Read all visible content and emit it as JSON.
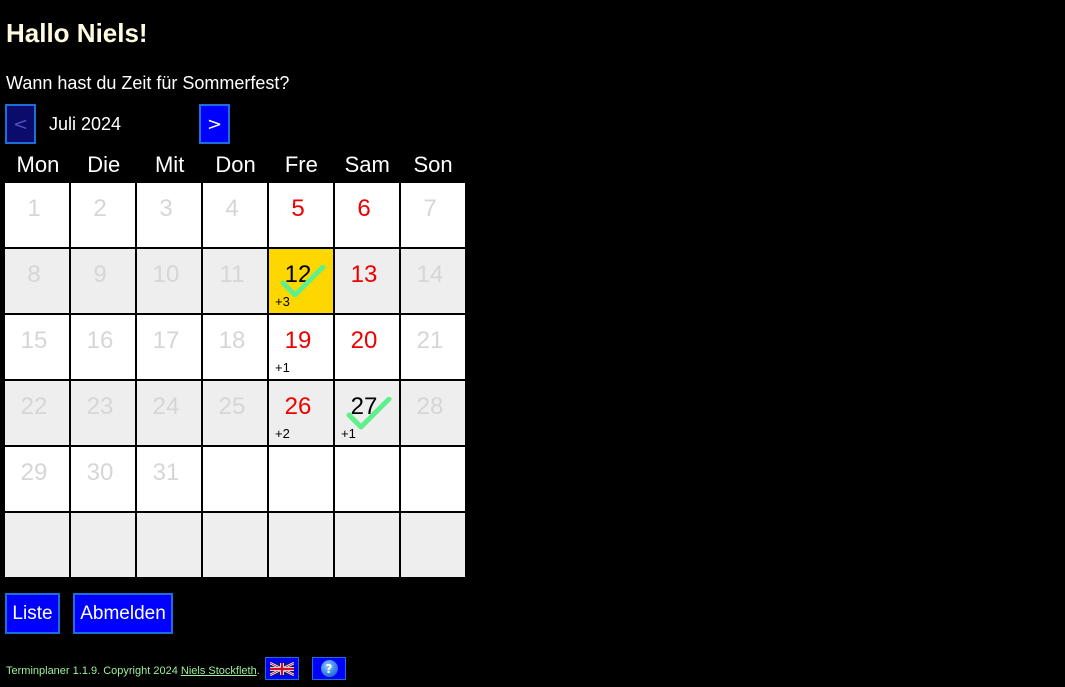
{
  "greeting": "Hallo Niels!",
  "question": "Wann hast du Zeit für Sommerfest?",
  "calendar": {
    "prev_label": "<",
    "next_label": ">",
    "month": "Juli 2024",
    "weekdays": [
      "Mon",
      "Die",
      "Mit",
      "Don",
      "Fre",
      "Sam",
      "Son"
    ],
    "rows": [
      [
        {
          "day": "1",
          "state": "inactive"
        },
        {
          "day": "2",
          "state": "inactive"
        },
        {
          "day": "3",
          "state": "inactive"
        },
        {
          "day": "4",
          "state": "inactive"
        },
        {
          "day": "5",
          "state": "active"
        },
        {
          "day": "6",
          "state": "active"
        },
        {
          "day": "7",
          "state": "inactive"
        }
      ],
      [
        {
          "day": "8",
          "state": "inactive"
        },
        {
          "day": "9",
          "state": "inactive"
        },
        {
          "day": "10",
          "state": "inactive"
        },
        {
          "day": "11",
          "state": "inactive"
        },
        {
          "day": "12",
          "state": "selected",
          "highlight": true,
          "checked": true,
          "count": "+3"
        },
        {
          "day": "13",
          "state": "active"
        },
        {
          "day": "14",
          "state": "inactive"
        }
      ],
      [
        {
          "day": "15",
          "state": "inactive"
        },
        {
          "day": "16",
          "state": "inactive"
        },
        {
          "day": "17",
          "state": "inactive"
        },
        {
          "day": "18",
          "state": "inactive"
        },
        {
          "day": "19",
          "state": "active",
          "count": "+1"
        },
        {
          "day": "20",
          "state": "active"
        },
        {
          "day": "21",
          "state": "inactive"
        }
      ],
      [
        {
          "day": "22",
          "state": "inactive"
        },
        {
          "day": "23",
          "state": "inactive"
        },
        {
          "day": "24",
          "state": "inactive"
        },
        {
          "day": "25",
          "state": "inactive"
        },
        {
          "day": "26",
          "state": "active",
          "count": "+2"
        },
        {
          "day": "27",
          "state": "selected",
          "checked": true,
          "count": "+1"
        },
        {
          "day": "28",
          "state": "inactive"
        }
      ],
      [
        {
          "day": "29",
          "state": "inactive"
        },
        {
          "day": "30",
          "state": "inactive"
        },
        {
          "day": "31",
          "state": "inactive"
        },
        {
          "day": "",
          "state": "empty"
        },
        {
          "day": "",
          "state": "empty"
        },
        {
          "day": "",
          "state": "empty"
        },
        {
          "day": "",
          "state": "empty"
        }
      ],
      [
        {
          "day": "",
          "state": "empty"
        },
        {
          "day": "",
          "state": "empty"
        },
        {
          "day": "",
          "state": "empty"
        },
        {
          "day": "",
          "state": "empty"
        },
        {
          "day": "",
          "state": "empty"
        },
        {
          "day": "",
          "state": "empty"
        },
        {
          "day": "",
          "state": "empty"
        }
      ]
    ]
  },
  "actions": {
    "list_label": "Liste",
    "logout_label": "Abmelden"
  },
  "footer": {
    "text": "Terminplaner 1.1.9. Copyright 2024 ",
    "author_link": "Niels Stockfleth",
    "suffix": ".",
    "language_icon": "uk-flag-icon",
    "help_icon": "help-icon"
  },
  "colors": {
    "background": "#000000",
    "button_blue": "#0000ff",
    "button_border": "#1c6fd6",
    "highlight_yellow": "#ffd700",
    "active_day_red": "#ee0000",
    "inactive_day_gray": "#d6d6d6",
    "check_green": "#5ef08a",
    "footer_green": "#9cf09c"
  }
}
